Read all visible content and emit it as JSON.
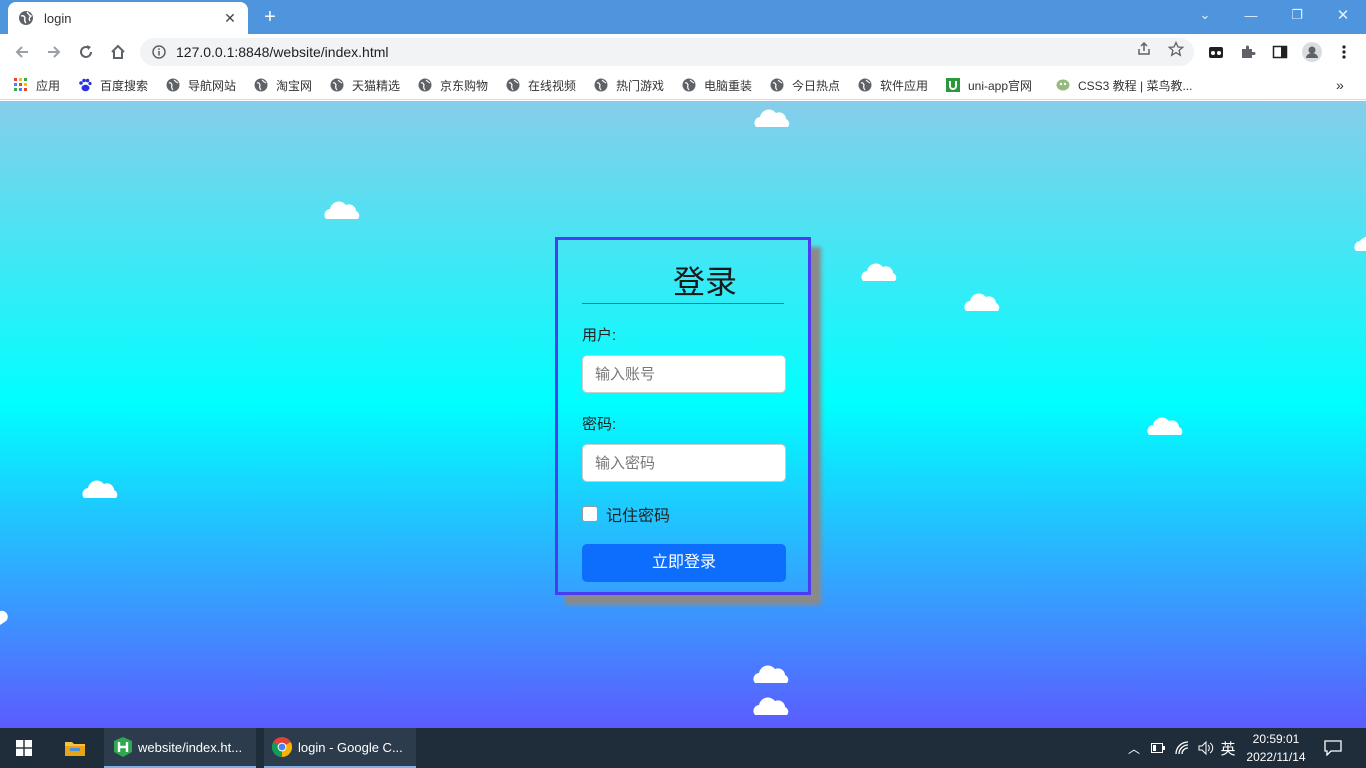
{
  "browser": {
    "tab_title": "login",
    "url": "127.0.0.1:8848/website/index.html"
  },
  "bookmarks": [
    {
      "label": "应用"
    },
    {
      "label": "百度搜索"
    },
    {
      "label": "导航网站"
    },
    {
      "label": "淘宝网"
    },
    {
      "label": "天猫精选"
    },
    {
      "label": "京东购物"
    },
    {
      "label": "在线视频"
    },
    {
      "label": "热门游戏"
    },
    {
      "label": "电脑重装"
    },
    {
      "label": "今日热点"
    },
    {
      "label": "软件应用"
    },
    {
      "label": "uni-app官网"
    },
    {
      "label": "CSS3 教程 | 菜鸟教..."
    }
  ],
  "login": {
    "title": "登录",
    "user_label": "用户:",
    "user_placeholder": "输入账号",
    "password_label": "密码:",
    "password_placeholder": "输入密码",
    "remember_label": "记住密码",
    "submit_label": "立即登录"
  },
  "taskbar": {
    "apps": [
      {
        "label": "website/index.ht..."
      },
      {
        "label": "login - Google C..."
      }
    ],
    "ime": "英",
    "time": "20:59:01",
    "date": "2022/11/14"
  },
  "colors": {
    "card_border": "#4a3cf0",
    "button": "#0d6efd",
    "gradient_top": "#87cdea",
    "gradient_mid": "#00ffff",
    "gradient_bottom": "#5b5cff"
  }
}
